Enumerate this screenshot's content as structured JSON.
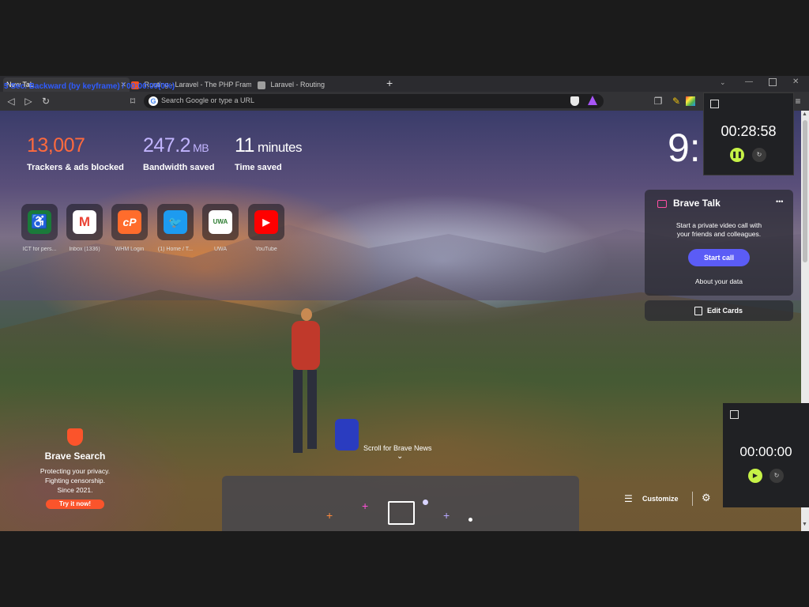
{
  "overlay_caption": "5 Sec. Backward (by keyframe) / 00:00:00(0%)",
  "tabs": [
    {
      "label": "New Tab",
      "active": true
    },
    {
      "label": "Routing - Laravel - The PHP Framework",
      "active": false
    },
    {
      "label": "Laravel - Routing",
      "active": false
    }
  ],
  "toolbar": {
    "url_placeholder": "Search Google or type a URL",
    "google_letter": "G"
  },
  "stats": [
    {
      "value": "13,007",
      "unit": "",
      "label": "Trackers & ads blocked",
      "color": "#ff6a3d"
    },
    {
      "value": "247.2",
      "unit": "MB",
      "label": "Bandwidth saved",
      "color": "#c2b5ff"
    },
    {
      "value": "11",
      "unit": "minutes",
      "label": "Time saved",
      "color": "#ffffff"
    }
  ],
  "clock": "9:",
  "top_sites": [
    {
      "label": "ICT for pers...",
      "icon": "accessibility-icon",
      "color": "#1a7a3a",
      "glyph": "♿"
    },
    {
      "label": "Inbox (1336)",
      "icon": "gmail-icon",
      "color": "#ffffff",
      "glyph": "M"
    },
    {
      "label": "WHM Login",
      "icon": "cpanel-icon",
      "color": "#ff6c2c",
      "glyph": "cP"
    },
    {
      "label": "(1) Home / T...",
      "icon": "twitter-icon",
      "color": "#1d9bf0",
      "glyph": "🐦"
    },
    {
      "label": "UWA",
      "icon": "uwa-logo-icon",
      "color": "#2e7d32",
      "glyph": "UWA"
    },
    {
      "label": "YouTube",
      "icon": "youtube-icon",
      "color": "#ff0000",
      "glyph": "▶"
    }
  ],
  "brave_talk": {
    "title": "Brave Talk",
    "description_line1": "Start a private video call with",
    "description_line2": "your friends and colleagues.",
    "start_button": "Start call",
    "about_link": "About your data",
    "menu": "•••"
  },
  "edit_cards": "Edit Cards",
  "brave_search": {
    "title": "Brave Search",
    "line1": "Protecting your privacy.",
    "line2": "Fighting censorship.",
    "line3": "Since 2021.",
    "button": "Try it now!"
  },
  "scroll_news": "Scroll for Brave News",
  "customize": "Customize",
  "timer_top": {
    "time": "00:28:58",
    "state": "running"
  },
  "timer_bottom": {
    "time": "00:00:00",
    "state": "paused"
  },
  "colors": {
    "accent_purple": "#5b5cf6",
    "timer_button": "#c6f247",
    "brave_orange": "#fb542b"
  }
}
